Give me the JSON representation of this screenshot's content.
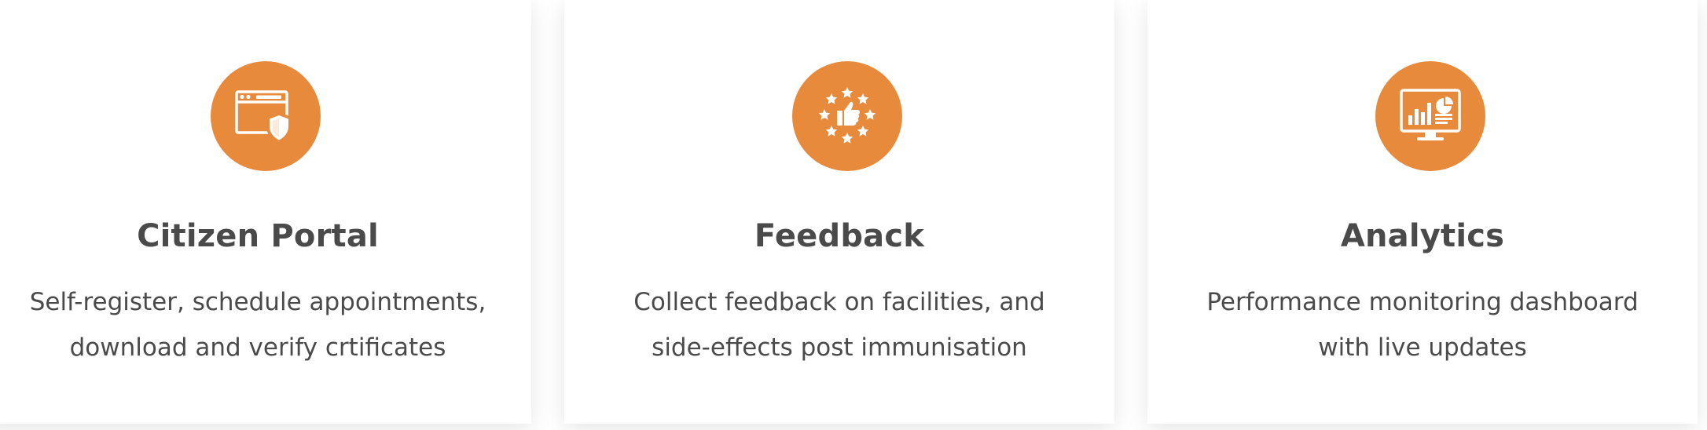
{
  "colors": {
    "accent": "#e88a3c",
    "text": "#4a4a4a",
    "background": "#ffffff"
  },
  "cards": [
    {
      "icon": "browser-shield-icon",
      "title": "Citizen Portal",
      "description_lines": [
        "Self-register, schedule appointments,",
        "download and verify crtificates"
      ]
    },
    {
      "icon": "thumbs-up-stars-icon",
      "title": "Feedback",
      "description_lines": [
        "Collect feedback on facilities, and",
        "side-effects post immunisation"
      ]
    },
    {
      "icon": "monitor-dashboard-icon",
      "title": "Analytics",
      "description_lines": [
        "Performance monitoring dashboard",
        "with live updates"
      ]
    }
  ]
}
